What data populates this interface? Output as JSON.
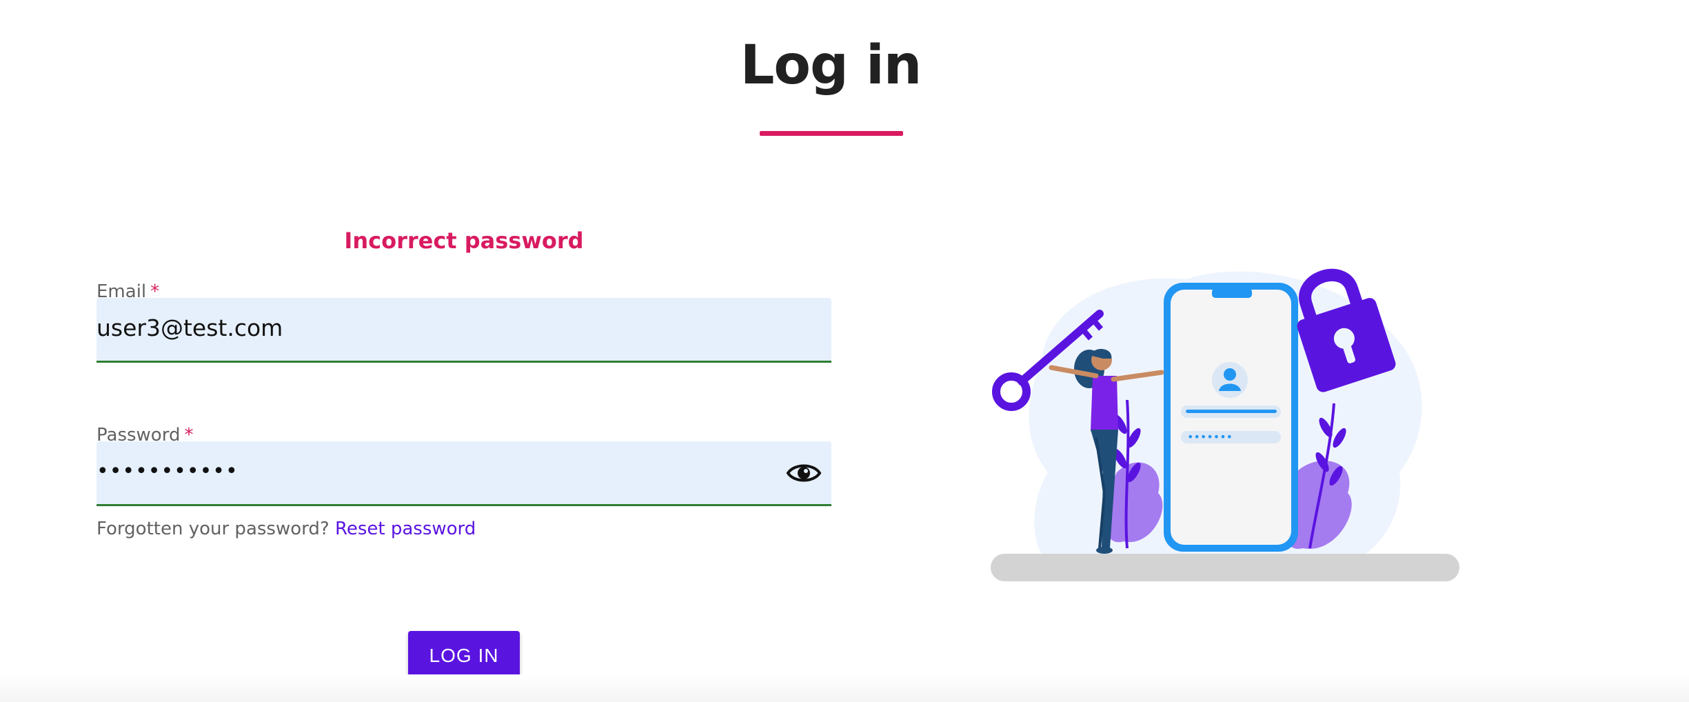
{
  "header": {
    "title": "Log in",
    "accent_color": "#d81b60"
  },
  "form": {
    "error": "Incorrect password",
    "email": {
      "label": "Email",
      "required_mark": "*",
      "value": "user3@test.com"
    },
    "password": {
      "label": "Password",
      "required_mark": "*",
      "value_masked": "•••••••••••",
      "toggle_icon": "eye-icon"
    },
    "forgot": {
      "text": "Forgotten your password?",
      "link": "Reset password"
    },
    "submit_label": "LOG IN",
    "brand_color": "#5a14e0"
  },
  "illustration": {
    "phone_password_dots": "•••••••"
  }
}
